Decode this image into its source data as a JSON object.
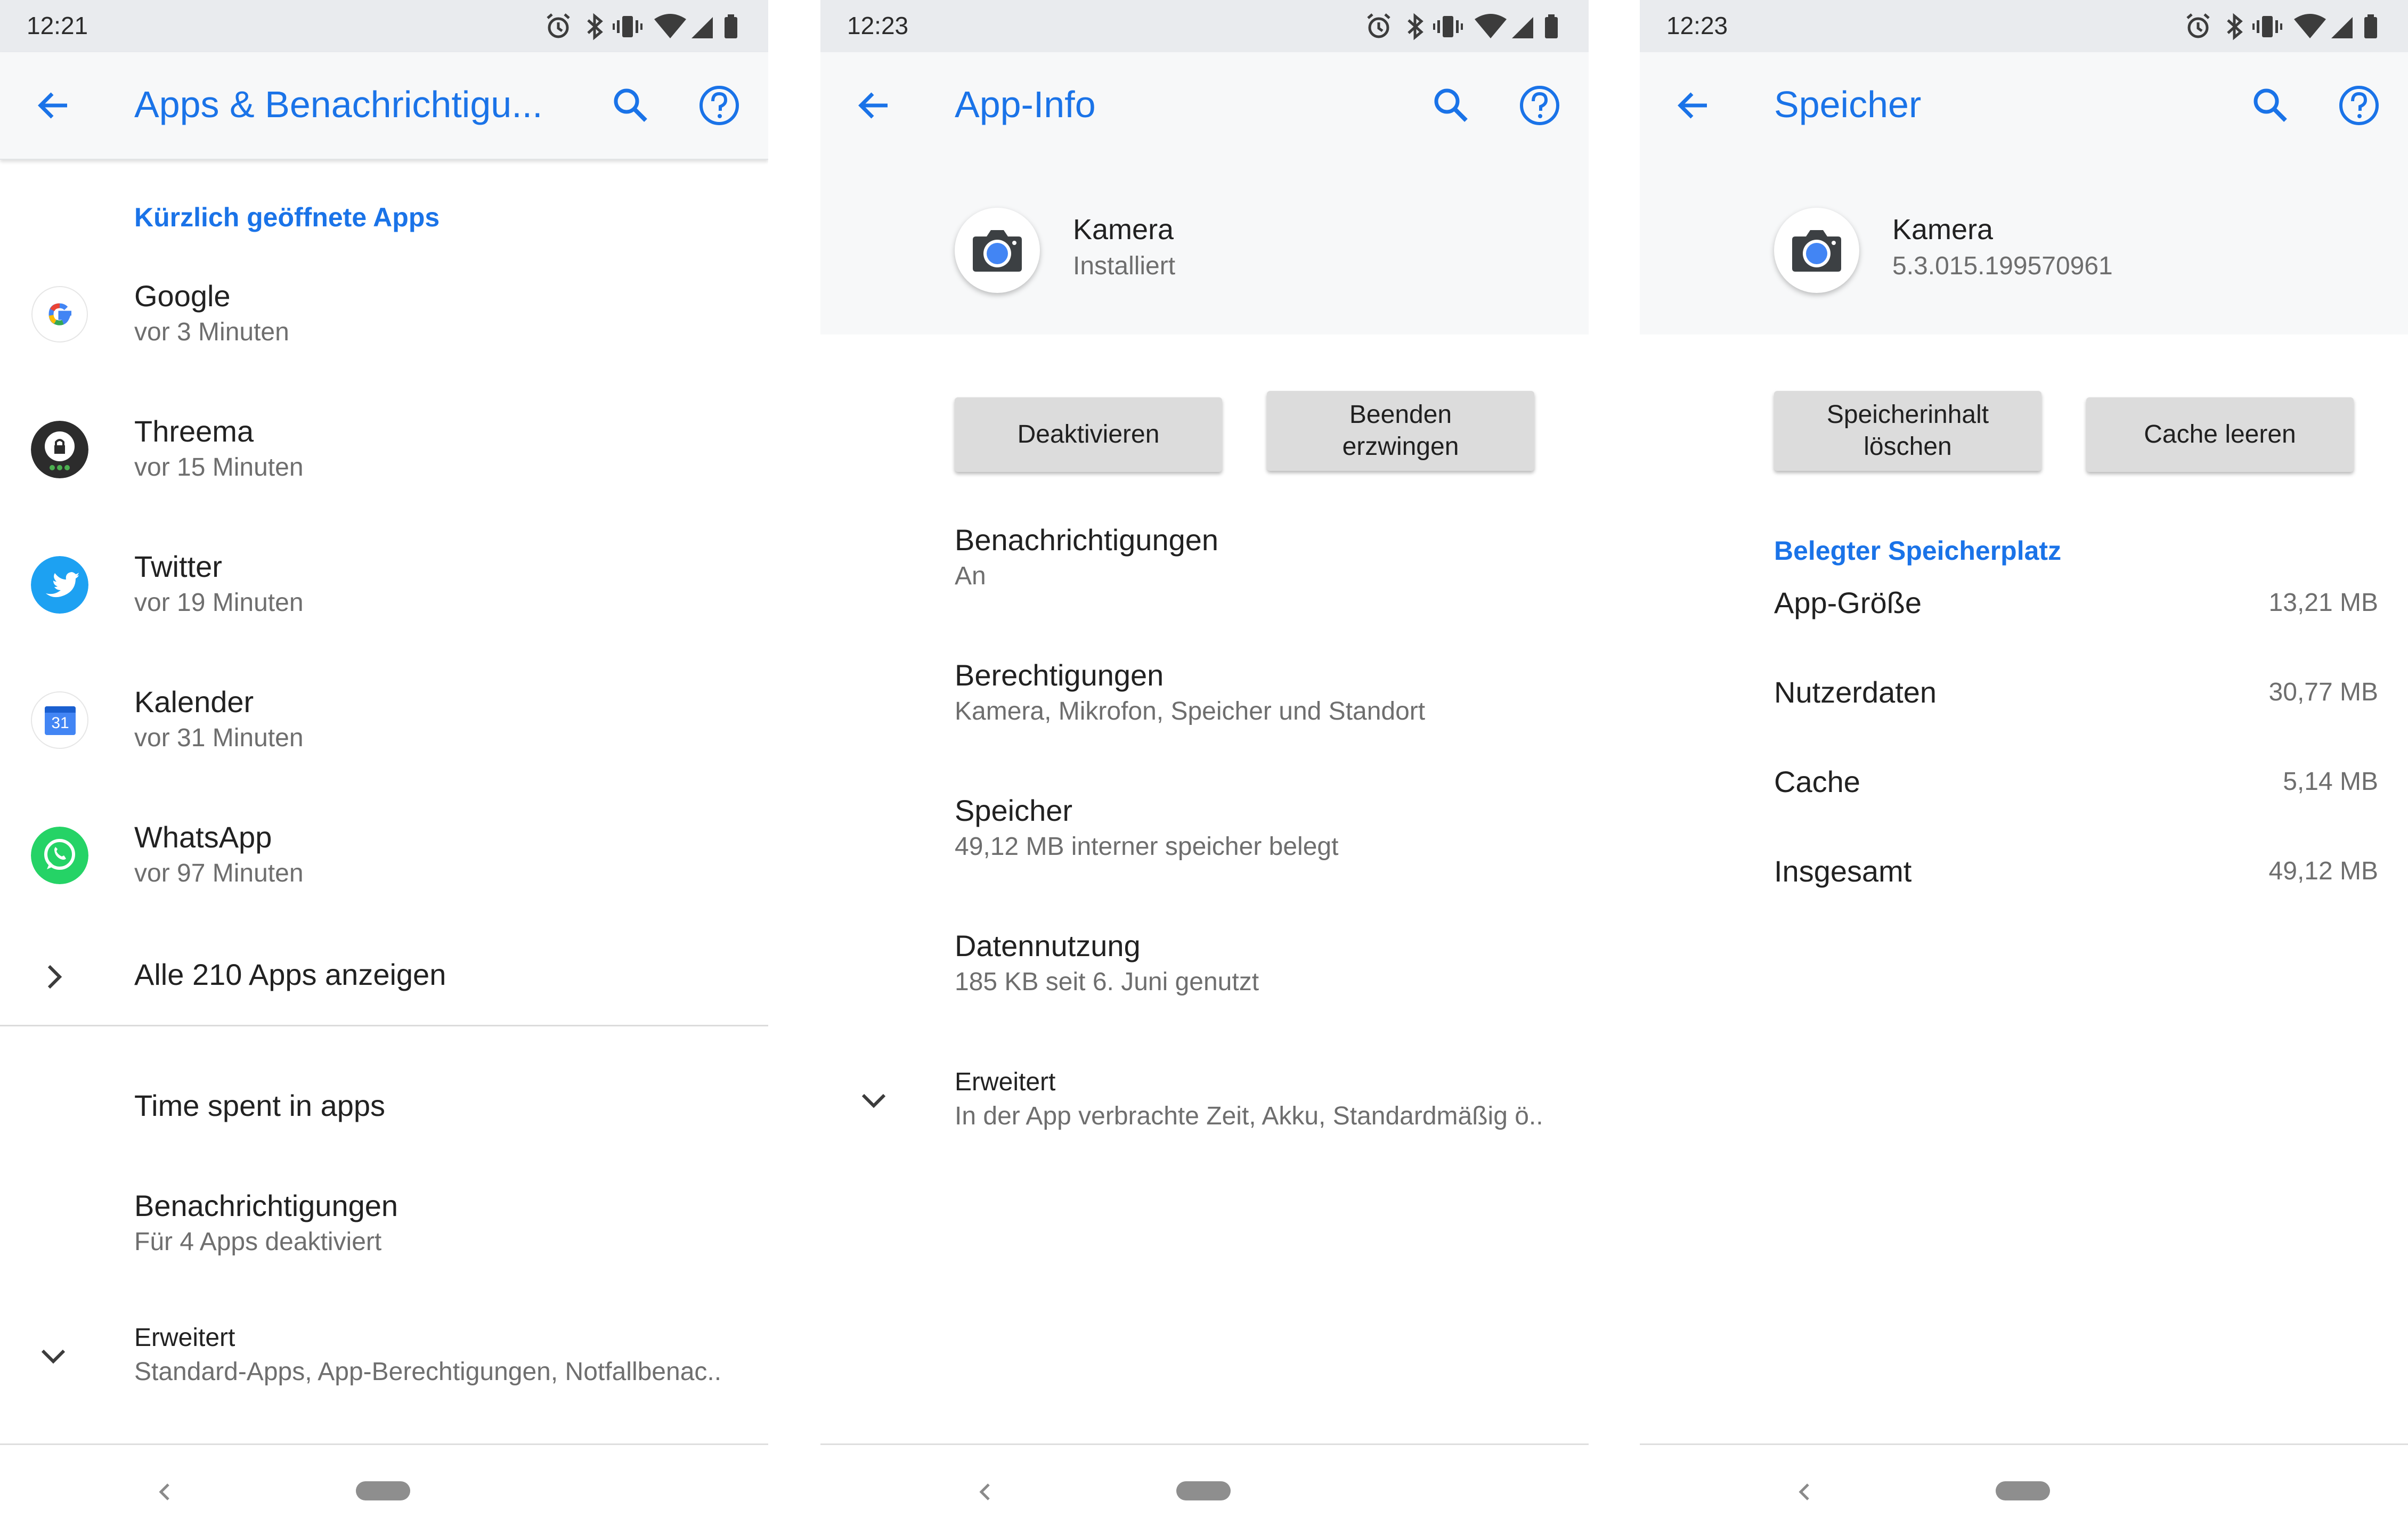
{
  "colors": {
    "accent": "#1a73e8",
    "statusbar": "#e9ebee",
    "appbar": "#f7f8f9",
    "button": "#dcdcdc"
  },
  "screen1": {
    "time": "12:21",
    "title": "Apps & Benachrichtigu...",
    "recent_label": "Kürzlich geöffnete Apps",
    "apps": [
      {
        "name": "Google",
        "time": "vor 3 Minuten",
        "icon": "google-icon"
      },
      {
        "name": "Threema",
        "time": "vor 15 Minuten",
        "icon": "threema-icon"
      },
      {
        "name": "Twitter",
        "time": "vor 19 Minuten",
        "icon": "twitter-icon"
      },
      {
        "name": "Kalender",
        "time": "vor 31 Minuten",
        "icon": "calendar-icon"
      },
      {
        "name": "WhatsApp",
        "time": "vor 97 Minuten",
        "icon": "whatsapp-icon"
      }
    ],
    "calendar_day": "31",
    "show_all": "Alle 210 Apps anzeigen",
    "time_spent": "Time spent in apps",
    "notifications": {
      "title": "Benachrichtigungen",
      "subtitle": "Für 4 Apps deaktiviert"
    },
    "advanced": {
      "title": "Erweitert",
      "subtitle": "Standard-Apps, App-Berechtigungen, Notfallbenac.."
    }
  },
  "screen2": {
    "time": "12:23",
    "title": "App-Info",
    "app_name": "Kamera",
    "app_status": "Installiert",
    "buttons": {
      "disable": "Deaktivieren",
      "force_stop_1": "Beenden",
      "force_stop_2": "erzwingen"
    },
    "items": [
      {
        "title": "Benachrichtigungen",
        "subtitle": "An"
      },
      {
        "title": "Berechtigungen",
        "subtitle": "Kamera, Mikrofon, Speicher und Standort"
      },
      {
        "title": "Speicher",
        "subtitle": "49,12 MB interner speicher belegt"
      },
      {
        "title": "Datennutzung",
        "subtitle": "185 KB seit 6. Juni genutzt"
      }
    ],
    "advanced": {
      "title": "Erweitert",
      "subtitle": "In der App verbrachte Zeit, Akku, Standardmäßig ö.."
    }
  },
  "screen3": {
    "time": "12:23",
    "title": "Speicher",
    "app_name": "Kamera",
    "app_version": "5.3.015.199570961",
    "buttons": {
      "clear_storage_1": "Speicherinhalt",
      "clear_storage_2": "löschen",
      "clear_cache": "Cache leeren"
    },
    "section_label": "Belegter Speicherplatz",
    "rows": [
      {
        "label": "App-Größe",
        "value": "13,21 MB"
      },
      {
        "label": "Nutzerdaten",
        "value": "30,77 MB"
      },
      {
        "label": "Cache",
        "value": "5,14 MB"
      },
      {
        "label": "Insgesamt",
        "value": "49,12 MB"
      }
    ]
  }
}
